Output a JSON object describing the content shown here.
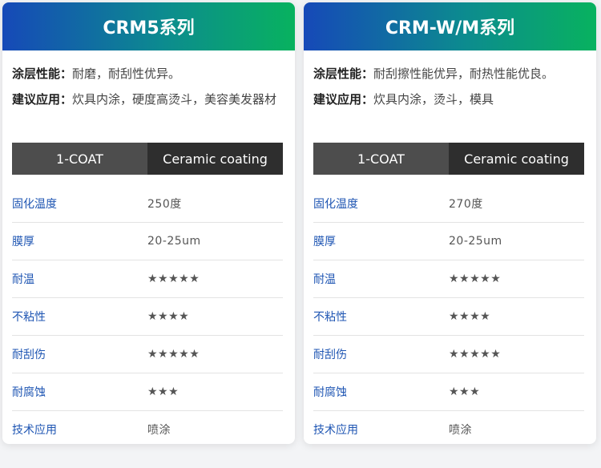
{
  "cards": [
    {
      "title": "CRM5系列",
      "coating_label": "涂层性能：",
      "coating_text": "耐磨，耐刮性优异。",
      "application_label": "建议应用：",
      "application_text": "炊具内涂，硬度高烫斗，美容美发器材",
      "coat_a": "1-COAT",
      "coat_b": "Ceramic coating",
      "specs": [
        {
          "key": "固化温度",
          "value": "250度"
        },
        {
          "key": "膜厚",
          "value": "20-25um"
        },
        {
          "key": "耐温",
          "value": "★★★★★"
        },
        {
          "key": "不粘性",
          "value": "★★★★"
        },
        {
          "key": "耐刮伤",
          "value": "★★★★★"
        },
        {
          "key": "耐腐蚀",
          "value": "★★★"
        },
        {
          "key": "技术应用",
          "value": "喷涂"
        }
      ]
    },
    {
      "title": "CRM-W/M系列",
      "coating_label": "涂层性能：",
      "coating_text": "耐刮擦性能优异，耐热性能优良。",
      "application_label": "建议应用：",
      "application_text": "炊具内涂，烫斗，模具",
      "coat_a": "1-COAT",
      "coat_b": "Ceramic coating",
      "specs": [
        {
          "key": "固化温度",
          "value": "270度"
        },
        {
          "key": "膜厚",
          "value": "20-25um"
        },
        {
          "key": "耐温",
          "value": "★★★★★"
        },
        {
          "key": "不粘性",
          "value": "★★★★"
        },
        {
          "key": "耐刮伤",
          "value": "★★★★★"
        },
        {
          "key": "耐腐蚀",
          "value": "★★★"
        },
        {
          "key": "技术应用",
          "value": "喷涂"
        }
      ]
    }
  ],
  "colors": {
    "header_gradient_start": "#1649b8",
    "header_gradient_end": "#08b25f",
    "spec_key": "#1f56b3",
    "coat_dark": "#2e2e2e",
    "coat_mid": "#4d4d4d"
  }
}
